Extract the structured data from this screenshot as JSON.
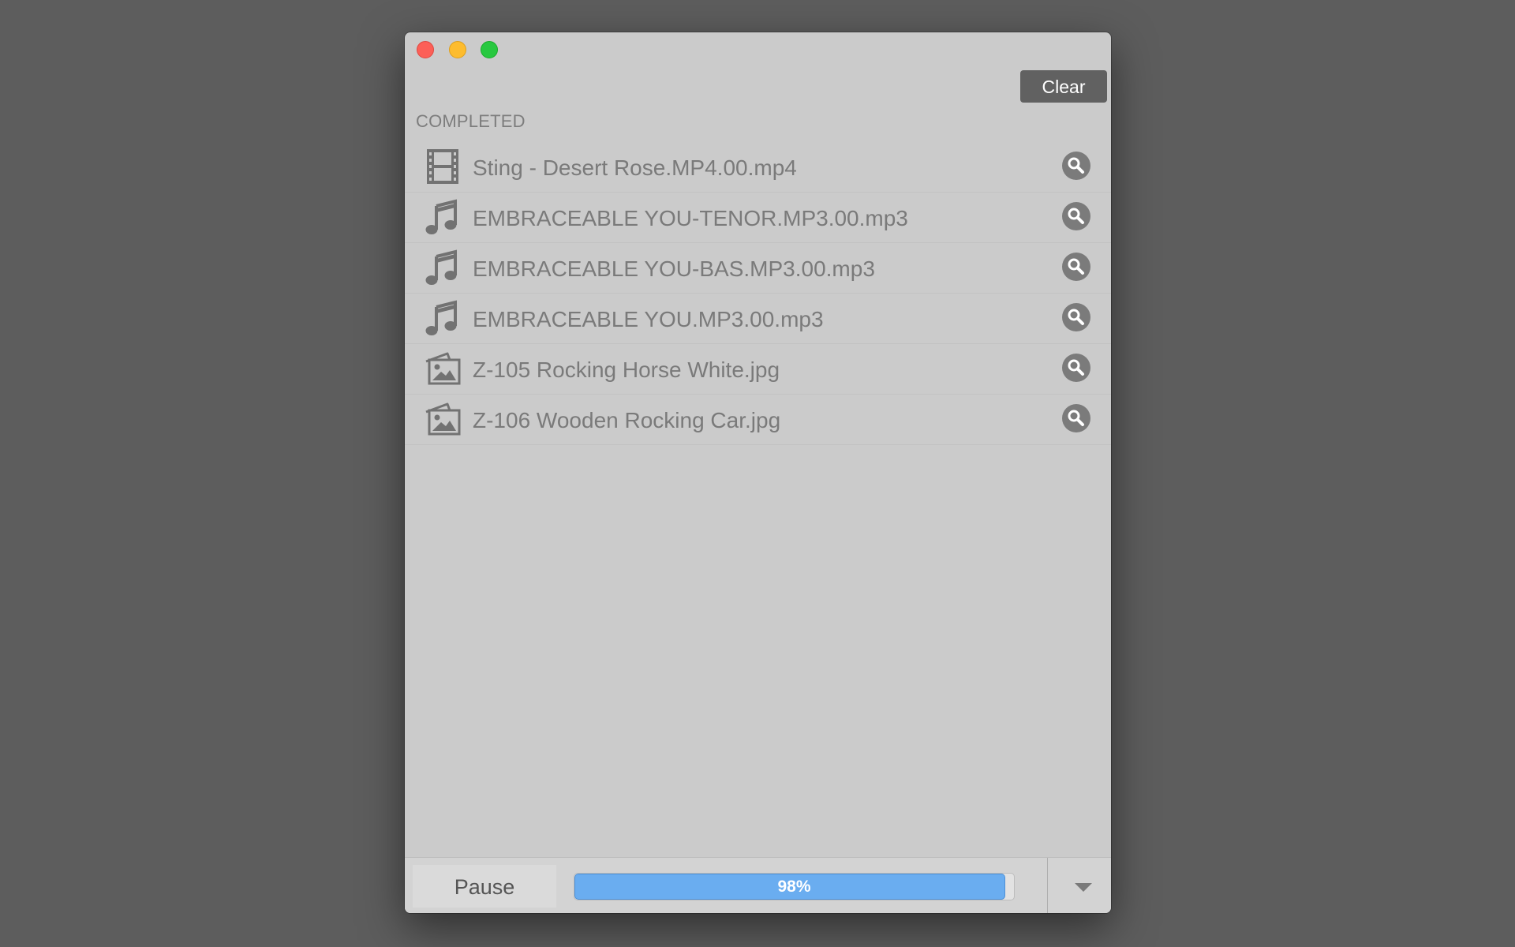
{
  "window": {
    "traffic_lights": {
      "close": "#fc5f57",
      "minimize": "#fdbc2e",
      "zoom": "#28c840"
    }
  },
  "header": {
    "section_label": "COMPLETED",
    "clear_label": "Clear"
  },
  "files": [
    {
      "name": "Sting - Desert Rose.MP4.00.mp4",
      "icon": "film-icon"
    },
    {
      "name": "EMBRACEABLE YOU-TENOR.MP3.00.mp3",
      "icon": "music-note-icon"
    },
    {
      "name": "EMBRACEABLE YOU-BAS.MP3.00.mp3",
      "icon": "music-note-icon"
    },
    {
      "name": "EMBRACEABLE YOU.MP3.00.mp3",
      "icon": "music-note-icon"
    },
    {
      "name": "Z-105 Rocking Horse White.jpg",
      "icon": "photo-icon"
    },
    {
      "name": "Z-106 Wooden Rocking Car.jpg",
      "icon": "photo-icon"
    }
  ],
  "footer": {
    "pause_label": "Pause",
    "progress_value": 98,
    "progress_label": "98%",
    "progress_color": "#6aadf0",
    "dropdown_icon": "triangle-down-icon"
  }
}
